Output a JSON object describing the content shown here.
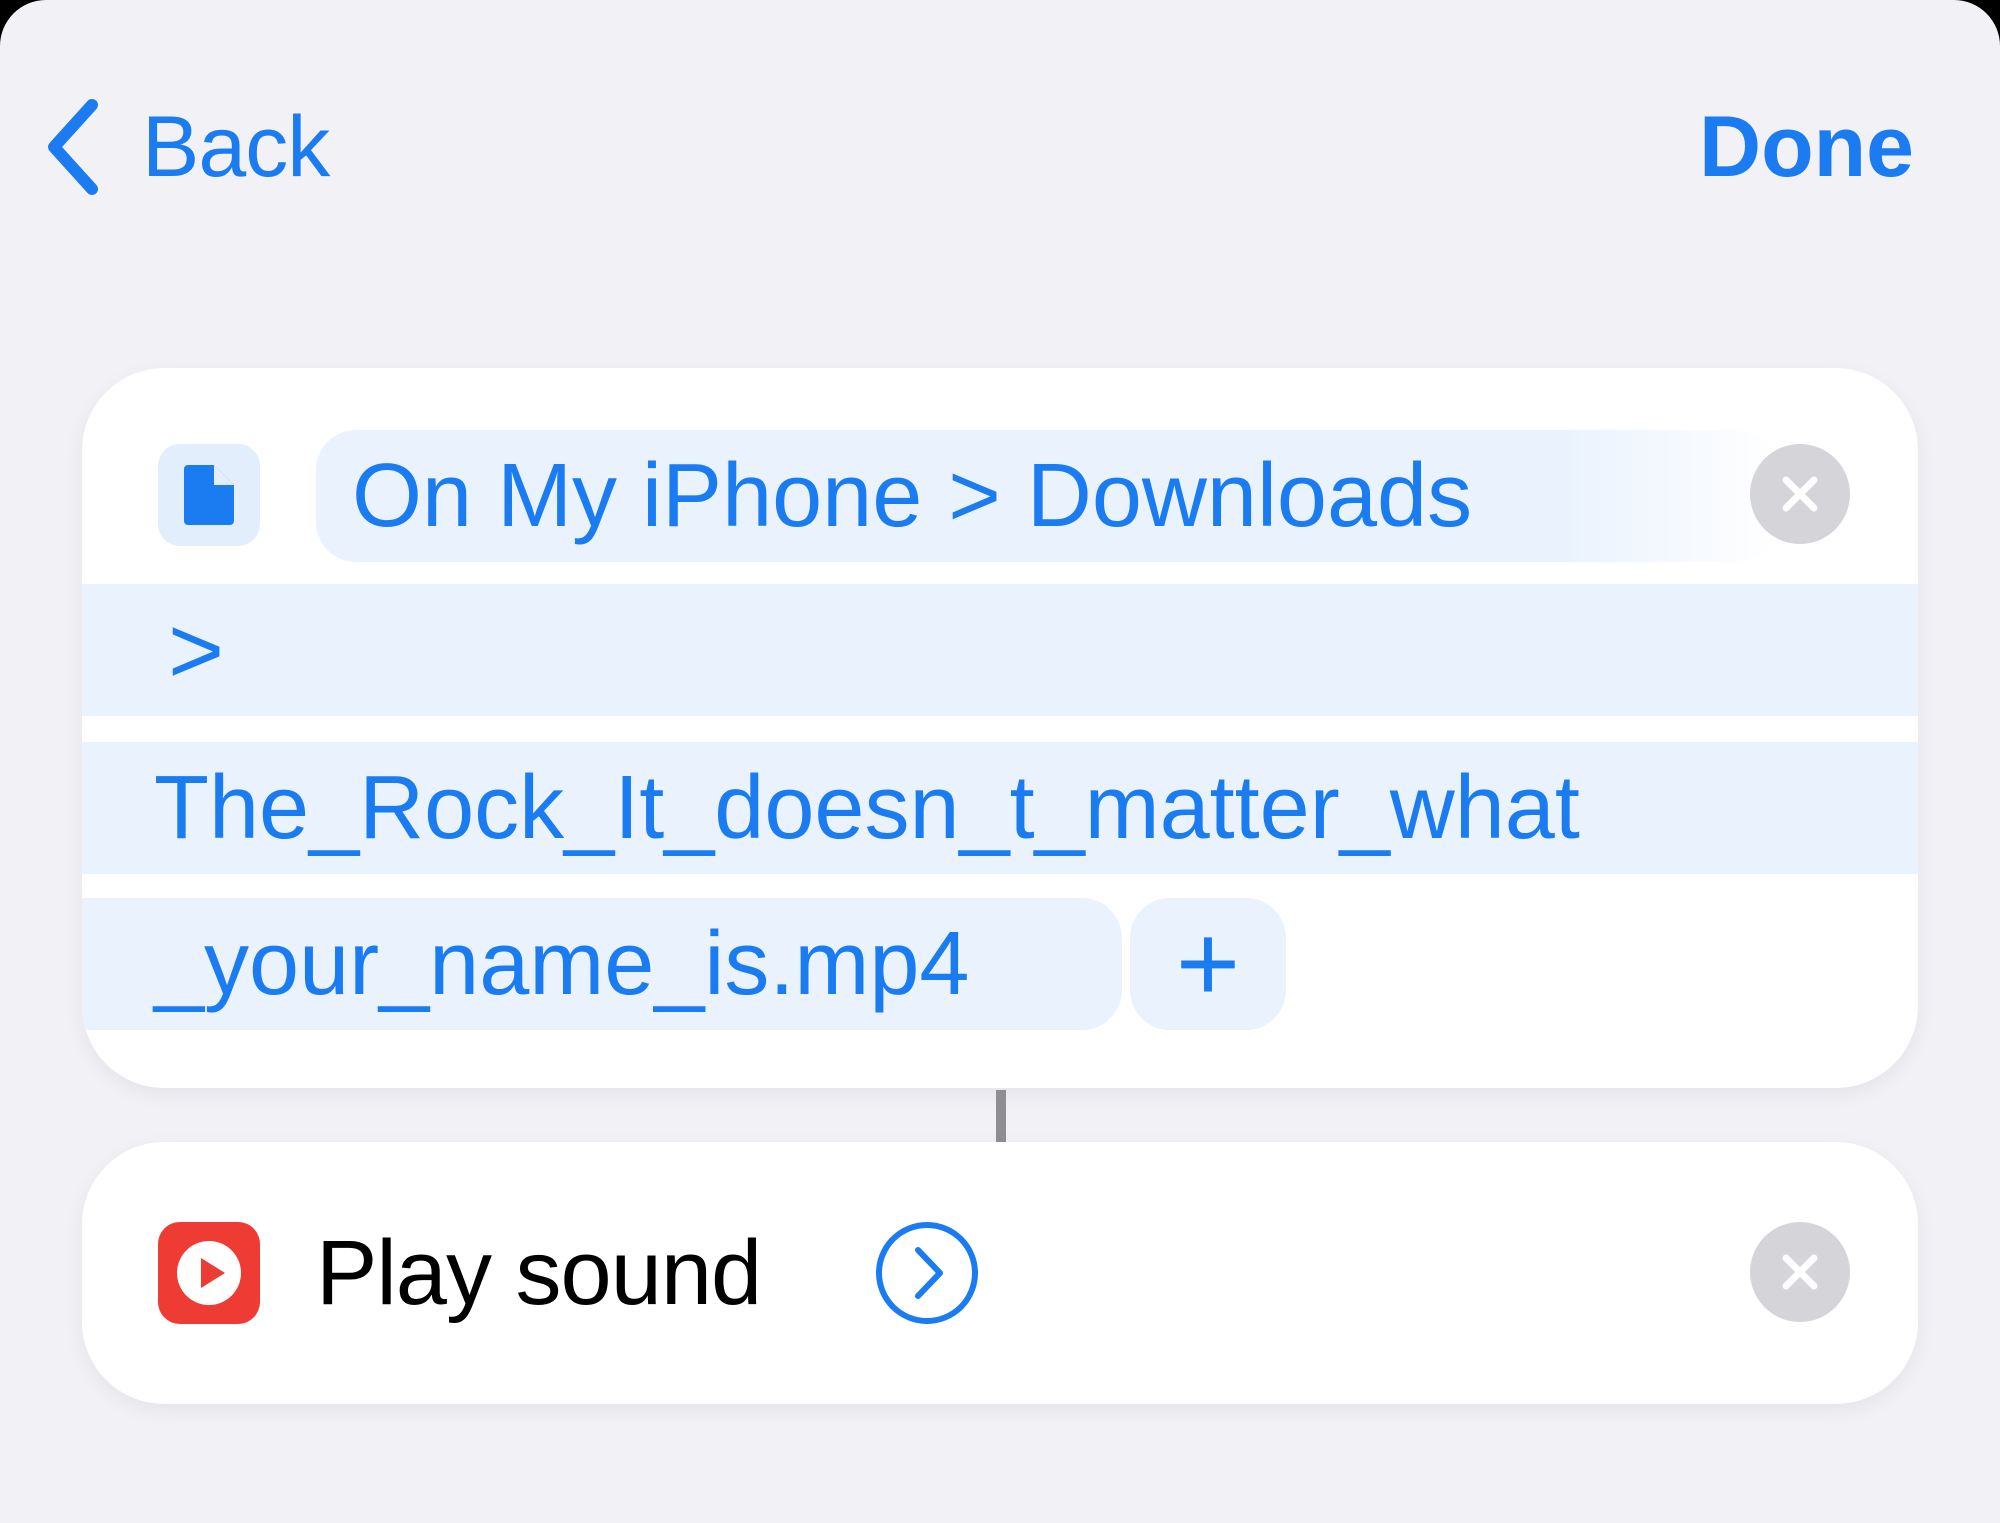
{
  "nav": {
    "back_label": "Back",
    "done_label": "Done"
  },
  "file_action": {
    "icon": "document-icon",
    "path": {
      "location": "On My iPhone",
      "separator": ">",
      "folder": "Downloads"
    },
    "subpath_separator": ">",
    "filename_line1": "The_Rock_It_doesn_t_matter_what",
    "filename_line2": "_your_name_is.mp4",
    "add_label": "+"
  },
  "sound_action": {
    "icon": "play-icon",
    "title": "Play sound"
  },
  "colors": {
    "accent": "#1a7cf0",
    "background": "#f1f1f6",
    "token_fill": "#e9f2fd",
    "remove_fill": "#d4d4d9",
    "sound_icon": "#ee3b34"
  }
}
